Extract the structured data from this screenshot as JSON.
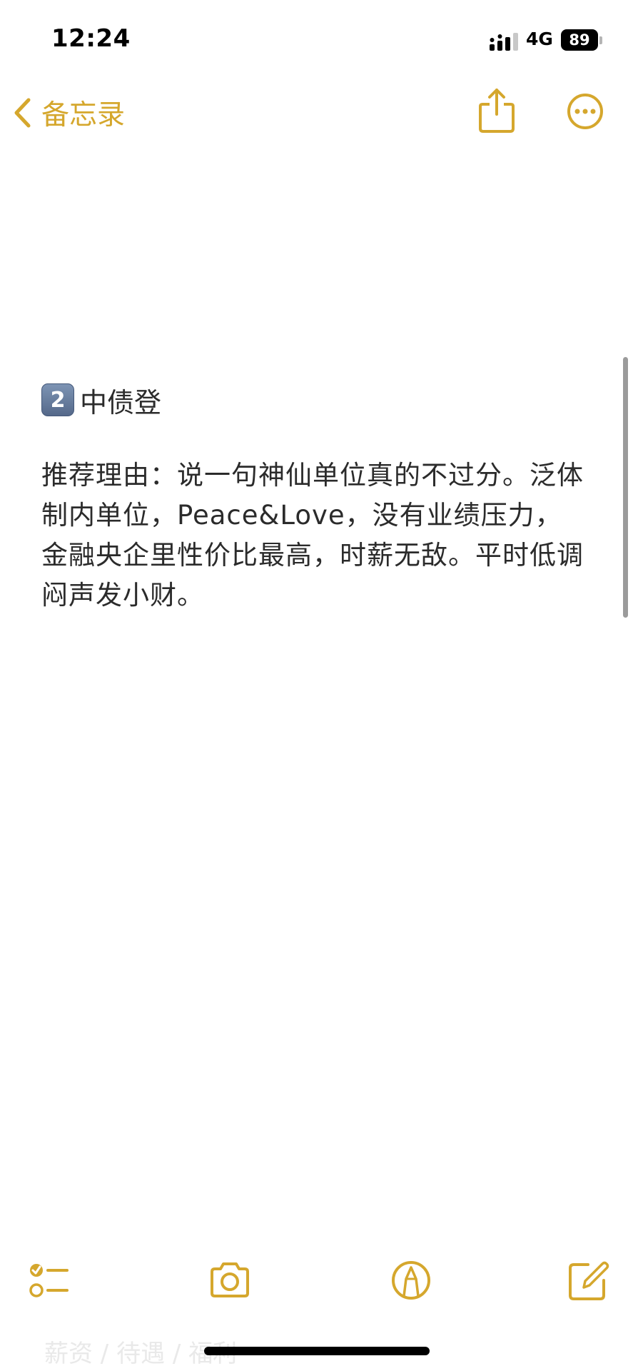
{
  "status_bar": {
    "time": "12:24",
    "network": "4G",
    "battery": "89"
  },
  "nav": {
    "back_label": "备忘录",
    "back_icon": "chevron-left-icon",
    "share_icon": "share-icon",
    "more_icon": "ellipsis-circle-icon"
  },
  "note": {
    "keycap": "2",
    "heading": "中债登",
    "body": "推荐理由：说一句神仙单位真的不过分。泛体制内单位，Peace&Love，没有业绩压力，金融央企里性价比最高，时薪无敌。平时低调闷声发小财。"
  },
  "toolbar": {
    "checklist_icon": "checklist-icon",
    "camera_icon": "camera-icon",
    "markup_icon": "markup-pen-icon",
    "compose_icon": "compose-icon"
  },
  "faded_text": "薪资 / 待遇 / 福利",
  "colors": {
    "accent": "#d5a72d",
    "text": "#2b2b2b",
    "background": "#ffffff"
  }
}
